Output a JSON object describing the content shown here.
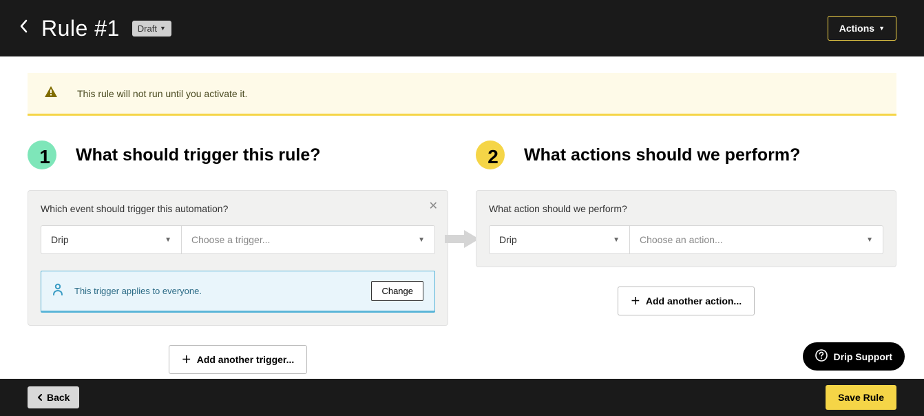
{
  "header": {
    "title": "Rule #1",
    "status_badge": "Draft",
    "actions_label": "Actions"
  },
  "alert": {
    "text": "This rule will not run until you activate it."
  },
  "trigger_section": {
    "number": "1",
    "title": "What should trigger this rule?",
    "panel_label": "Which event should trigger this automation?",
    "provider": "Drip",
    "placeholder": "Choose a trigger...",
    "applies_text": "This trigger applies to everyone.",
    "change_label": "Change",
    "add_label": "Add another trigger..."
  },
  "action_section": {
    "number": "2",
    "title": "What actions should we perform?",
    "panel_label": "What action should we perform?",
    "provider": "Drip",
    "placeholder": "Choose an action...",
    "add_label": "Add another action..."
  },
  "footer": {
    "back_label": "Back",
    "save_label": "Save Rule"
  },
  "support_label": "Drip Support"
}
